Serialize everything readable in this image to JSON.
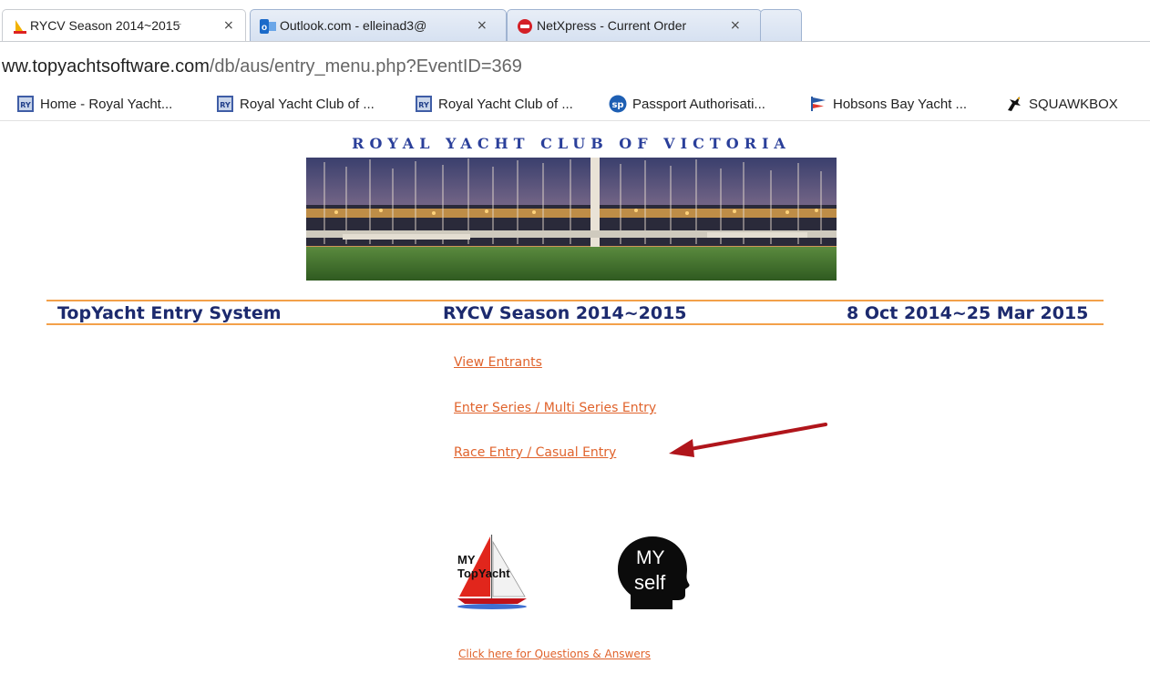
{
  "browser": {
    "tabs": [
      {
        "title": "RYCV Season 2014~2015",
        "close": "×",
        "active": true
      },
      {
        "title": "Outlook.com - elleinad3@",
        "close": "×",
        "active": false
      },
      {
        "title": "NetXpress - Current Order",
        "close": "×",
        "active": false
      }
    ],
    "url_host": "ww.topyachtsoftware.com",
    "url_path": "/db/aus/entry_menu.php?EventID=369",
    "bookmarks": [
      {
        "label": "Home - Royal Yacht...",
        "icon": "ryc-logo-icon"
      },
      {
        "label": "Royal Yacht Club of ...",
        "icon": "ryc-logo-icon"
      },
      {
        "label": "Royal Yacht Club of ...",
        "icon": "ryc-logo-icon"
      },
      {
        "label": "Passport Authorisati...",
        "icon": "sp-icon"
      },
      {
        "label": "Hobsons Bay Yacht ...",
        "icon": "flag-icon"
      },
      {
        "label": "SQUAWKBOX",
        "icon": "bird-icon"
      }
    ]
  },
  "page": {
    "club_title": "ROYAL YACHT CLUB OF VICTORIA",
    "header": {
      "system": "TopYacht Entry System",
      "season": "RYCV Season 2014~2015",
      "dates": "8 Oct 2014~25 Mar 2015"
    },
    "links": {
      "view_entrants": "View Entrants",
      "series_entry": "Enter Series / Multi Series Entry",
      "race_entry": "Race Entry / Casual Entry",
      "qa": "Click here for Questions & Answers"
    },
    "logos": {
      "mytopyacht_line1": "MY",
      "mytopyacht_line2": "TopYacht",
      "myself_line1": "MY",
      "myself_line2": "self"
    }
  },
  "colors": {
    "link": "#e0632c",
    "header_rule": "#f3a04a",
    "header_text": "#1c2a6e",
    "annotation_arrow": "#b0151b"
  }
}
